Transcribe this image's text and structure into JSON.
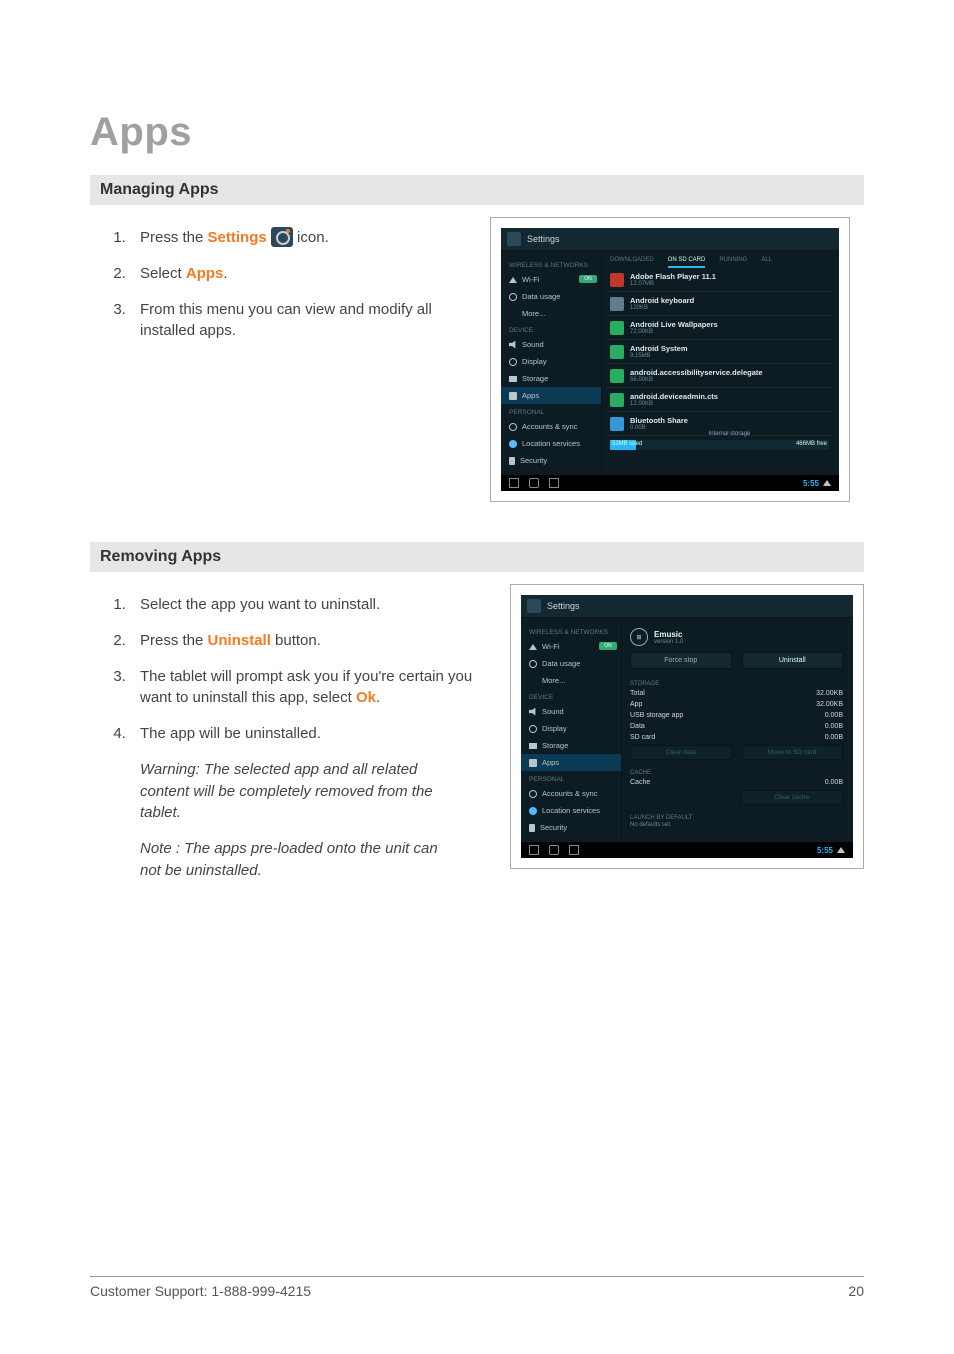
{
  "page": {
    "title": "Apps",
    "footer_left": "Customer Support: 1-888-999-4215",
    "footer_right": "20"
  },
  "section1": {
    "header": "Managing Apps",
    "step1_pre": "Press the ",
    "step1_link": "Settings",
    "step1_post": " icon.",
    "step2_pre": "Select ",
    "step2_link": "Apps",
    "step2_post": ".",
    "step3": "From this menu you can view and modify all installed apps."
  },
  "section2": {
    "header": "Removing Apps",
    "step1": "Select the app you want to uninstall.",
    "step2_pre": "Press the ",
    "step2_link": "Uninstall",
    "step2_post": " button.",
    "step3_pre": "The tablet will prompt ask you if you're certain you want to uninstall this app, select ",
    "step3_link": "Ok",
    "step3_post": ".",
    "step4": "The app will be uninstalled.",
    "warning": "Warning: The selected app and all related content will be completely removed from the tablet.",
    "note": "Note : The apps pre-loaded onto the unit can not be uninstalled."
  },
  "shot1": {
    "title": "Settings",
    "side": {
      "cat1": "WIRELESS & NETWORKS",
      "wifi": "Wi-Fi",
      "wifi_toggle": "ON",
      "data": "Data usage",
      "more": "More...",
      "cat2": "DEVICE",
      "sound": "Sound",
      "display": "Display",
      "storage": "Storage",
      "apps": "Apps",
      "cat3": "PERSONAL",
      "accounts": "Accounts & sync",
      "location": "Location services",
      "security": "Security"
    },
    "tabs": {
      "t1": "DOWNLOADED",
      "t2": "ON SD CARD",
      "t3": "RUNNING",
      "t4": "ALL"
    },
    "apps": [
      {
        "name": "Adobe Flash Player 11.1",
        "size": "12.07MB"
      },
      {
        "name": "Android keyboard",
        "size": "120KB"
      },
      {
        "name": "Android Live Wallpapers",
        "size": "72.00KB"
      },
      {
        "name": "Android System",
        "size": "9.15MB"
      },
      {
        "name": "android.accessibilityservice.delegate",
        "size": "56.00KB"
      },
      {
        "name": "android.deviceadmin.cts",
        "size": "12.00KB"
      },
      {
        "name": "Bluetooth Share",
        "size": "0.00B"
      }
    ],
    "storage": {
      "used": "53MB used",
      "label": "Internal storage",
      "free": "466MB free"
    },
    "time": "5:55"
  },
  "shot2": {
    "title": "Settings",
    "side": {
      "cat1": "WIRELESS & NETWORKS",
      "wifi": "Wi-Fi",
      "wifi_toggle": "ON",
      "data": "Data usage",
      "more": "More...",
      "cat2": "DEVICE",
      "sound": "Sound",
      "display": "Display",
      "storage": "Storage",
      "apps": "Apps",
      "cat3": "PERSONAL",
      "accounts": "Accounts & sync",
      "location": "Location services",
      "security": "Security"
    },
    "detail": {
      "name": "Emusic",
      "version": "version 1.0",
      "btn_force": "Force stop",
      "btn_uninstall": "Uninstall",
      "h_storage": "STORAGE",
      "total_k": "Total",
      "total_v": "32.00KB",
      "app_k": "App",
      "app_v": "32.00KB",
      "usb_k": "USB storage app",
      "usb_v": "0.00B",
      "data_k": "Data",
      "data_v": "0.00B",
      "sd_k": "SD card",
      "sd_v": "0.00B",
      "btn_cleardata": "Clear data",
      "btn_move": "Move to SD card",
      "h_cache": "CACHE",
      "cache_k": "Cache",
      "cache_v": "0.00B",
      "btn_clearcache": "Clear cache",
      "h_launch": "LAUNCH BY DEFAULT",
      "launch_txt": "No defaults set."
    },
    "time": "5:55"
  }
}
